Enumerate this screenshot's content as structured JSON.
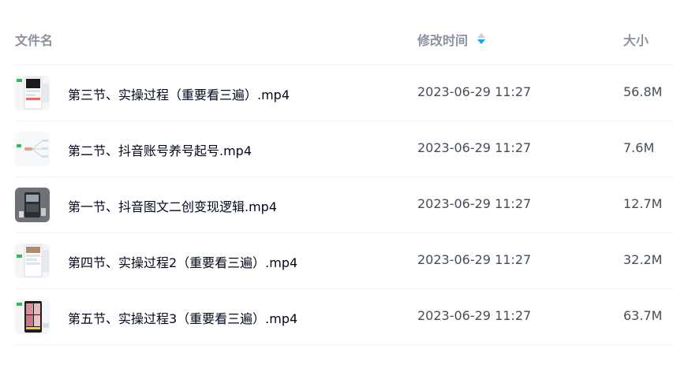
{
  "header": {
    "name": "文件名",
    "time": "修改时间",
    "size": "大小"
  },
  "colors": {
    "header_text": "#8a919f",
    "name_text": "#03081a",
    "meta_text": "#454d5a",
    "sort_active": "#06a7ff",
    "divider": "#f0f2f5"
  },
  "files": [
    {
      "name": "第三节、实操过程（重要看三遍）.mp4",
      "time": "2023-06-29 11:27",
      "size": "56.8M",
      "thumb": "video-thumbnail-phone-screens"
    },
    {
      "name": "第二节、抖音账号养号起号.mp4",
      "time": "2023-06-29 11:27",
      "size": "7.6M",
      "thumb": "video-thumbnail-mindmap"
    },
    {
      "name": "第一节、抖音图文二创变现逻辑.mp4",
      "time": "2023-06-29 11:27",
      "size": "12.7M",
      "thumb": "video-thumbnail-dark"
    },
    {
      "name": "第四节、实操过程2（重要看三遍）.mp4",
      "time": "2023-06-29 11:27",
      "size": "32.2M",
      "thumb": "video-thumbnail-phone-screens"
    },
    {
      "name": "第五节、实操过程3（重要看三遍）.mp4",
      "time": "2023-06-29 11:27",
      "size": "63.7M",
      "thumb": "video-thumbnail-photos"
    }
  ]
}
